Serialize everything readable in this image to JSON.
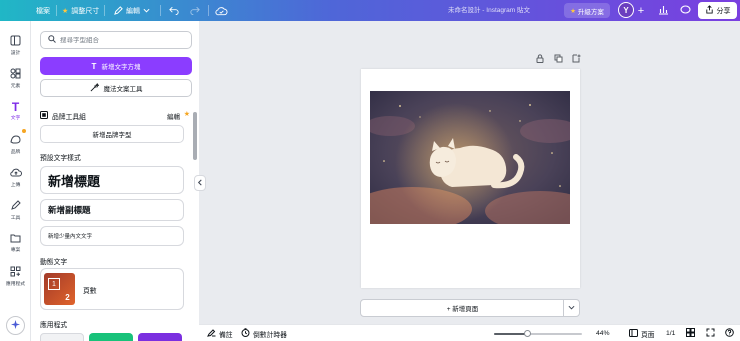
{
  "topbar": {
    "file_label": "檔案",
    "resize_label": "調整尺寸",
    "edit_label": "編輯",
    "doc_title": "未命名設計 - Instagram 貼文",
    "upgrade_label": "升級方案",
    "avatar_initial": "Y",
    "share_label": "分享",
    "accent_gradient": [
      "#20b7c6",
      "#4f66d8",
      "#7a3fe0"
    ]
  },
  "rail": {
    "items": [
      {
        "label": "設計",
        "icon": "layout-icon"
      },
      {
        "label": "元素",
        "icon": "shapes-icon"
      },
      {
        "label": "文字",
        "icon": "text-icon"
      },
      {
        "label": "品牌",
        "icon": "brand-icon"
      },
      {
        "label": "上傳",
        "icon": "upload-icon"
      },
      {
        "label": "工具",
        "icon": "draw-icon"
      },
      {
        "label": "專案",
        "icon": "folder-icon"
      },
      {
        "label": "應用程式",
        "icon": "apps-icon"
      }
    ],
    "active": "文字"
  },
  "panel": {
    "search_placeholder": "搜尋字型組合",
    "add_textbox": "新增文字方塊",
    "magic_write": "魔法文案工具",
    "brand_kit": "品牌工具組",
    "brand_edit": "編輯",
    "add_brand_font": "新增品牌字型",
    "default_styles_title": "預設文字樣式",
    "styles": {
      "heading": "新增標題",
      "subheading": "新增副標題",
      "body": "新增少量內文文字"
    },
    "dynamic_title": "動態文字",
    "dynamic_item": "頁數",
    "apps_title": "應用程式",
    "accent": "#8b3dff"
  },
  "canvas": {
    "add_page": "+ 新增頁面"
  },
  "bottombar": {
    "notes": "備註",
    "timer": "倒數計時器",
    "zoom": "44%",
    "zoom_fraction": 0.44,
    "pages_label": "頁面",
    "page_count": "1/1"
  }
}
